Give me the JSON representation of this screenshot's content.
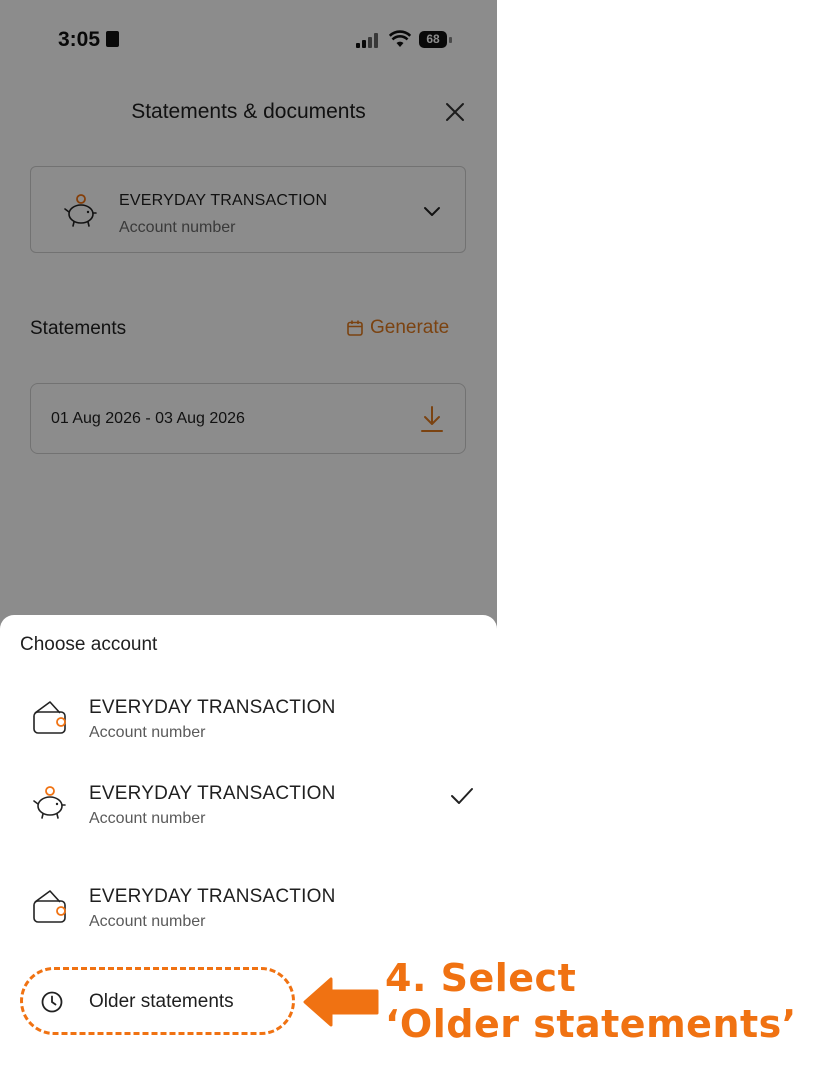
{
  "status_bar": {
    "time": "3:05",
    "battery": "68"
  },
  "header": {
    "title": "Statements & documents"
  },
  "selected_account": {
    "name": "EVERYDAY TRANSACTION",
    "number_label": "Account number"
  },
  "statements": {
    "section_title": "Statements",
    "generate_label": "Generate",
    "items": [
      {
        "range": "01 Aug 2026 - 03 Aug 2026"
      }
    ]
  },
  "sheet": {
    "title": "Choose account",
    "accounts": [
      {
        "name": "EVERYDAY TRANSACTION",
        "number_label": "Account number",
        "icon": "wallet-icon",
        "selected": false
      },
      {
        "name": "EVERYDAY TRANSACTION",
        "number_label": "Account number",
        "icon": "piggy-bank-icon",
        "selected": true
      },
      {
        "name": "EVERYDAY TRANSACTION",
        "number_label": "Account number",
        "icon": "wallet-icon",
        "selected": false
      }
    ],
    "older_label": "Older statements"
  },
  "annotation": {
    "line1": "4. Select",
    "line2": "‘Older statements’"
  },
  "colors": {
    "accent": "#f07212",
    "generate": "#e07a1f",
    "overlay": "rgba(0,0,0,0.45)"
  }
}
